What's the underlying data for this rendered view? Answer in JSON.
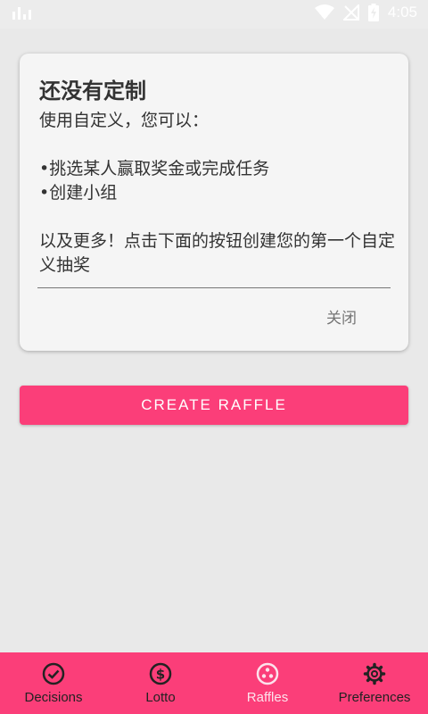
{
  "status_bar": {
    "time": "4:05"
  },
  "card": {
    "title": "还没有定制",
    "body": "使用自定义，您可以：\n\n•挑选某人赢取奖金或完成任务\n•创建小组\n\n以及更多！点击下面的按钮创建您的第一个自定义抽奖",
    "close_label": "关闭"
  },
  "create_button": {
    "label": "CREATE RAFFLE"
  },
  "nav": {
    "items": [
      {
        "label": "Decisions",
        "icon": "check-circle-icon"
      },
      {
        "label": "Lotto",
        "icon": "dollar-circle-icon"
      },
      {
        "label": "Raffles",
        "icon": "raffle-dots-icon",
        "active": true
      },
      {
        "label": "Preferences",
        "icon": "gear-icon"
      }
    ]
  },
  "colors": {
    "accent": "#fb3e79",
    "background": "#e9e9e9",
    "card": "#f5f5f5"
  }
}
